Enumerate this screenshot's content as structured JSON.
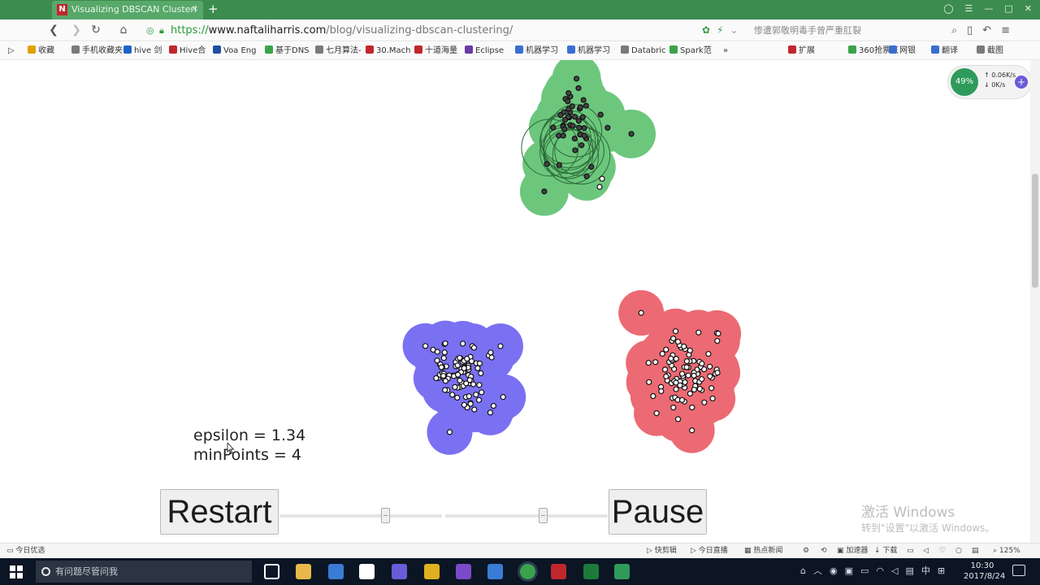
{
  "browser": {
    "tab_title": "Visualizing DBSCAN Clusteri",
    "tab_favicon": "N",
    "url_protocol": "https://",
    "url_host": "www.naftaliharris.com",
    "url_path": "/blog/visualizing-dbscan-clustering/",
    "search_placeholder": "惨遭郭敬明毒手曾严重肛裂",
    "zoom": "125%"
  },
  "bookmarks": [
    {
      "label": "收藏",
      "color": "#e0a100"
    },
    {
      "label": "手机收藏夹",
      "color": "#7a7a7a"
    },
    {
      "label": "hive 剑",
      "color": "#1a66c7"
    },
    {
      "label": "Hive合",
      "color": "#c0262d"
    },
    {
      "label": "Voa Eng",
      "color": "#1e4fa0"
    },
    {
      "label": "基于DNS",
      "color": "#3aa34a"
    },
    {
      "label": "七月算法-",
      "color": "#7a7a7a"
    },
    {
      "label": "30.Mach",
      "color": "#c0262d"
    },
    {
      "label": "十道海量",
      "color": "#c0262d"
    },
    {
      "label": "Eclipse",
      "color": "#6a3aa0"
    },
    {
      "label": "机器学习",
      "color": "#3a6fd0"
    },
    {
      "label": "机器学习",
      "color": "#3a6fd0"
    },
    {
      "label": "Databric",
      "color": "#7a7a7a"
    },
    {
      "label": "Spark范",
      "color": "#3aa34a"
    }
  ],
  "bookmarks_right": [
    {
      "label": "扩展",
      "color": "#c0262d"
    },
    {
      "label": "360抢票王",
      "color": "#3aa34a"
    },
    {
      "label": "网银",
      "color": "#3a6fd0"
    },
    {
      "label": "翻译",
      "color": "#3a6fd0"
    },
    {
      "label": "截图",
      "color": "#7a7a7a"
    }
  ],
  "net_widget": {
    "percent": "49%",
    "up": "0.06K/s",
    "down": "0K/s"
  },
  "visualization": {
    "epsilon_text": "epsilon = 1.34",
    "minpoints_text": "minPoints = 4",
    "restart_label": "Restart",
    "pause_label": "Pause",
    "slider_epsilon_value": 0.65,
    "slider_minpoints_value": 0.6,
    "clusters": [
      {
        "name": "green",
        "color": "#6cc77d"
      },
      {
        "name": "blue",
        "color": "#7a70f2"
      },
      {
        "name": "red",
        "color": "#ec6a73"
      }
    ]
  },
  "watermark": {
    "line1": "激活 Windows",
    "line2": "转到\"设置\"以激活 Windows。"
  },
  "statusbar": {
    "left": "今日优选",
    "items": [
      "快剪辑",
      "今日直播",
      "热点新闻"
    ],
    "accelerator": "加速器",
    "download": "下载",
    "zoom": "125%"
  },
  "taskbar": {
    "search_placeholder": "有问题尽管问我",
    "time": "10:30",
    "date": "2017/8/24",
    "ime": "中"
  }
}
